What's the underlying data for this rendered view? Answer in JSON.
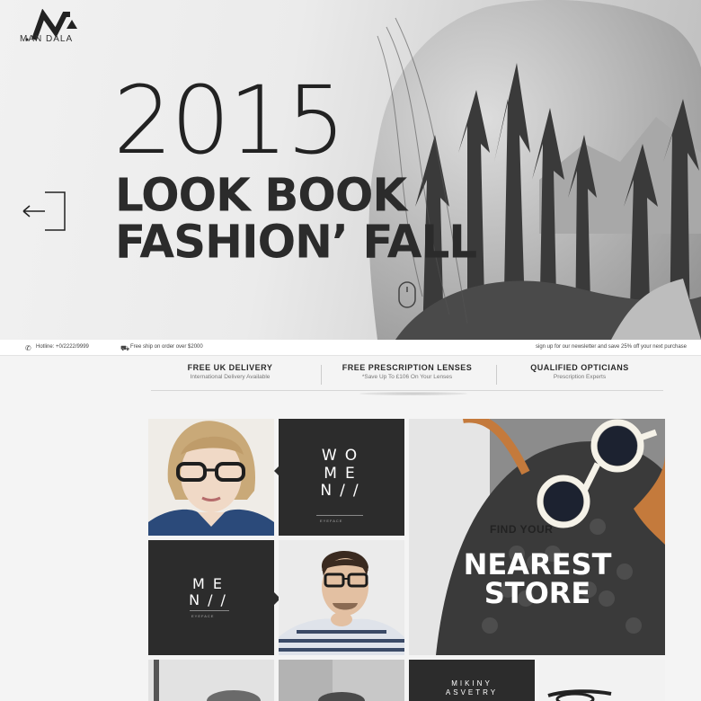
{
  "brand": {
    "name": "MAN DALA"
  },
  "hero": {
    "year": "2015",
    "line1": "LOOK BOOK",
    "line2": "FASHION’ FALL"
  },
  "infobar": {
    "phone": "Hotline: +0/2222/9999",
    "shipping": "Free ship on order over $2000",
    "newsletter": "sign up for our newsletter and save 25% off your next purchase"
  },
  "features": [
    {
      "title": "FREE UK DELIVERY",
      "subtitle": "International Delivery Available"
    },
    {
      "title": "FREE PRESCRIPTION LENSES",
      "subtitle": "*Save Up To £106 On Your Lenses"
    },
    {
      "title": "QUALIFIED OPTICIANS",
      "subtitle": "Prescription Experts"
    }
  ],
  "tiles": {
    "women": {
      "line1": "WO",
      "line2": "ME",
      "line3": "N//",
      "sub": "EYEFACE"
    },
    "men": {
      "line1": "ME",
      "line2": "N//",
      "sub": "EYEFACE"
    },
    "store": {
      "small": "FIND YOUR",
      "big1": "NEAREST",
      "big2": "STORE"
    },
    "bottom": {
      "line1": "MIKINY",
      "line2": "ASVETRY"
    }
  },
  "colors": {
    "dark_tile": "#2c2c2c",
    "hero_text": "#2b2b2b",
    "page_bg": "#f4f4f4"
  },
  "icons": [
    "logo-mark",
    "arrow-left-icon",
    "mouse-scroll-icon",
    "phone-icon",
    "truck-icon"
  ]
}
